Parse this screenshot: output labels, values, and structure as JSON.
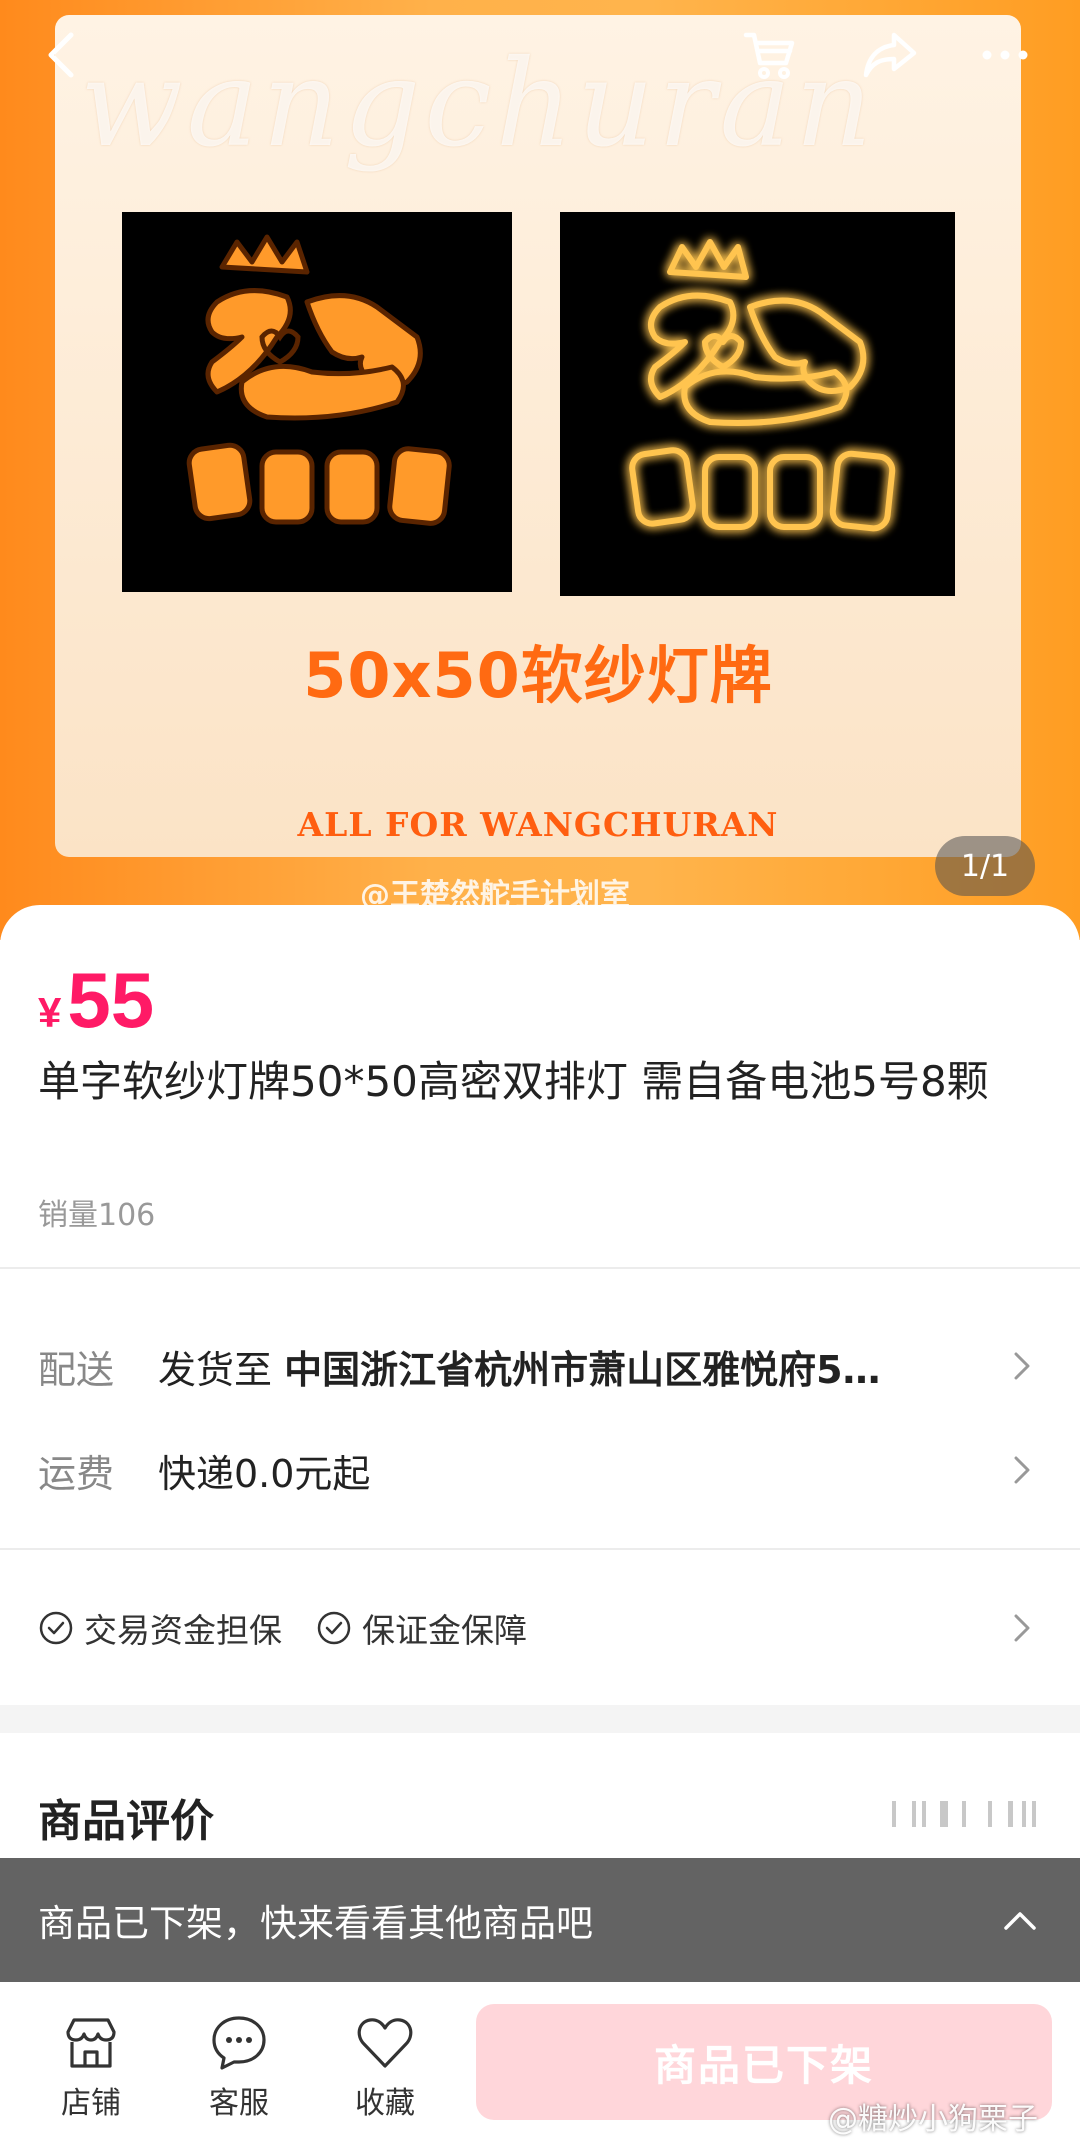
{
  "hero": {
    "watermark": "wangchuran",
    "caption": "50x50软纱灯牌",
    "subcaption": "ALL FOR WANGCHURAN",
    "studio": "@王楚然舵手计划室",
    "counter": "1/1"
  },
  "icons": {
    "back": "back-arrow-icon",
    "cart": "cart-icon",
    "share": "share-icon",
    "more": "more-icon"
  },
  "product": {
    "currency": "¥",
    "price": "55",
    "title": "单字软纱灯牌50*50高密双排灯 需自备电池5号8颗",
    "sales": "销量106"
  },
  "delivery": {
    "label": "配送",
    "prefix": "发货至",
    "address": "中国浙江省杭州市萧山区雅悦府5…"
  },
  "shipping": {
    "label": "运费",
    "value": "快递0.0元起"
  },
  "guarantees": [
    "交易资金担保",
    "保证金保障"
  ],
  "reviews": {
    "title": "商品评价"
  },
  "banner": {
    "text": "商品已下架，快来看看其他商品吧"
  },
  "bottom": {
    "tabs": [
      "店铺",
      "客服",
      "收藏"
    ],
    "button": "商品已下架"
  },
  "watermark_source": "@糖炒小狗栗子",
  "colors": {
    "price": "#ff1a66",
    "disabled_button": "#ffd6da",
    "banner": "#636363",
    "hero_orange": "#ff8a1c"
  }
}
